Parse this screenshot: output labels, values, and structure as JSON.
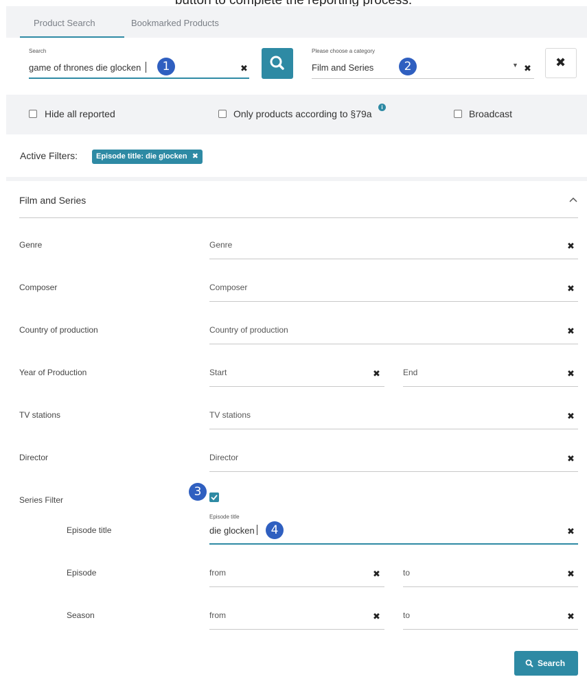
{
  "intro_text": "button to complete the reporting process.",
  "tabs": [
    {
      "label": "Product Search"
    },
    {
      "label": "Bookmarked Products"
    }
  ],
  "search": {
    "label": "Search",
    "value": "game of thrones die glocken",
    "category_label": "Please choose a category",
    "category_value": "Film and Series"
  },
  "options": {
    "hide_reported": "Hide all reported",
    "only_79a": "Only products according to §79a",
    "broadcast": "Broadcast"
  },
  "active_filters": {
    "label": "Active Filters:",
    "chip": "Episode title: die glocken"
  },
  "section": {
    "title": "Film and Series"
  },
  "rows": {
    "genre": {
      "label": "Genre",
      "placeholder": "Genre"
    },
    "composer": {
      "label": "Composer",
      "placeholder": "Composer"
    },
    "country": {
      "label": "Country of production",
      "placeholder": "Country of production"
    },
    "year": {
      "label": "Year of Production",
      "start": "Start",
      "end": "End"
    },
    "tv": {
      "label": "TV stations",
      "placeholder": "TV stations"
    },
    "director": {
      "label": "Director",
      "placeholder": "Director"
    },
    "series_filter": {
      "label": "Series Filter"
    },
    "episode_title": {
      "label": "Episode title",
      "field_label": "Episode title",
      "value": "die glocken"
    },
    "episode": {
      "label": "Episode",
      "from": "from",
      "to": "to"
    },
    "season": {
      "label": "Season",
      "from": "from",
      "to": "to"
    }
  },
  "markers": [
    "1",
    "2",
    "3",
    "4"
  ],
  "search_button": {
    "label": "Search"
  },
  "icons": {
    "search": "search-icon",
    "clear": "close-icon",
    "caret": "caret-down-icon",
    "collapse": "chevron-up-icon",
    "info": "info-icon",
    "check": "check-icon"
  },
  "colors": {
    "accent": "#2e8aa4",
    "marker": "#2f5fc0",
    "panel": "#f2f3f5"
  }
}
